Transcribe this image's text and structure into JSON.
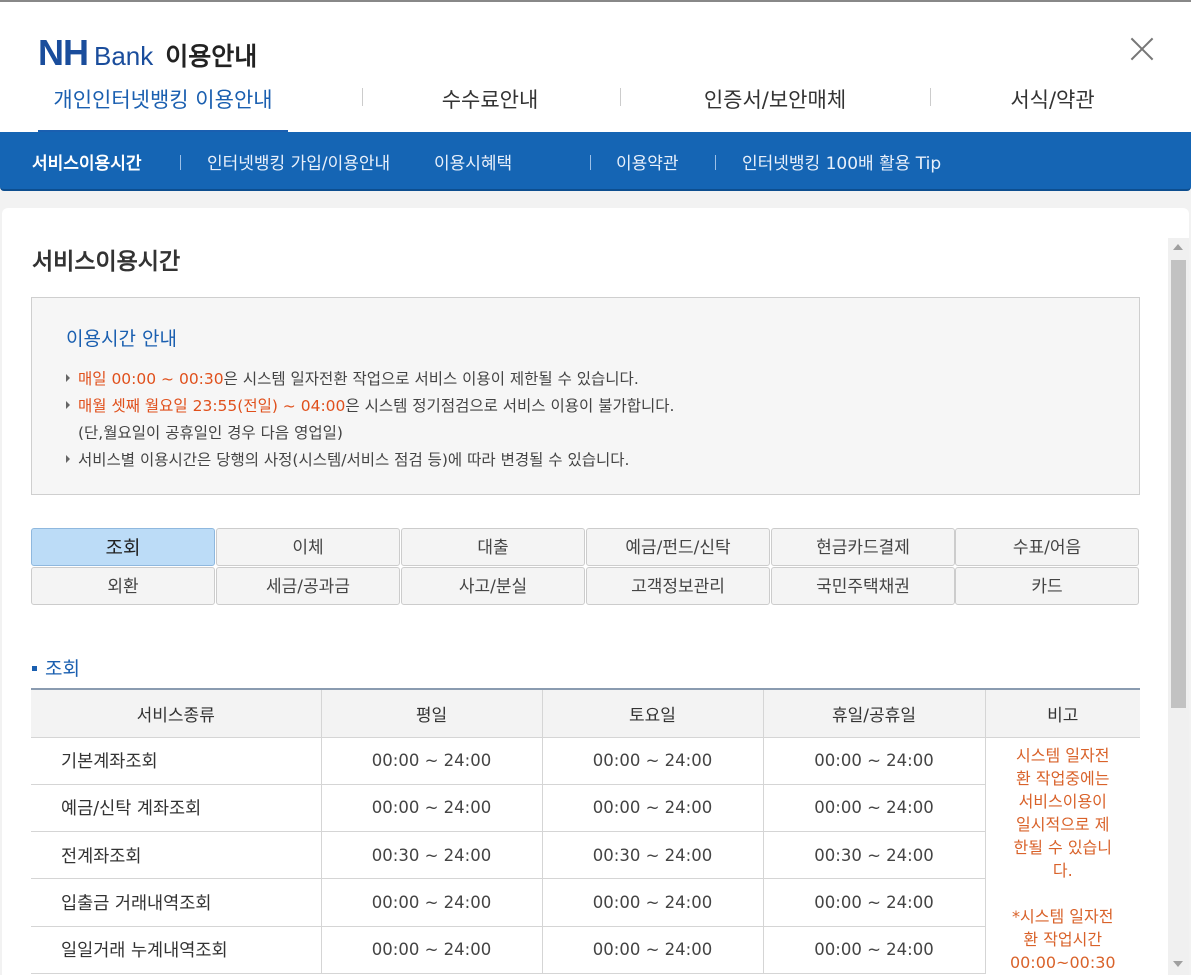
{
  "header": {
    "brand_nh": "NH",
    "brand_bank": "Bank",
    "title": "이용안내",
    "close_icon": "close-icon"
  },
  "main_tabs": [
    {
      "label": "개인인터넷뱅킹 이용안내",
      "active": true
    },
    {
      "label": "수수료안내",
      "active": false
    },
    {
      "label": "인증서/보안매체",
      "active": false
    },
    {
      "label": "서식/약관",
      "active": false
    }
  ],
  "subnav": [
    {
      "label": "서비스이용시간",
      "active": true
    },
    {
      "label": "인터넷뱅킹 가입/이용안내",
      "active": false
    },
    {
      "label": "이용시혜택",
      "active": false
    },
    {
      "label": "이용약관",
      "active": false
    },
    {
      "label": "인터넷뱅킹 100배 활용 Tip",
      "active": false
    }
  ],
  "page_title": "서비스이용시간",
  "notice": {
    "title": "이용시간 안내",
    "line1_hl": "매일 00:00 ~ 00:30",
    "line1_rest": "은 시스템 일자전환 작업으로 서비스 이용이 제한될 수 있습니다.",
    "line2_hl": "매월 셋째 월요일 23:55(전일) ~ 04:00",
    "line2_rest": "은 시스템 정기점검으로 서비스 이용이 불가합니다.",
    "line2_note": "(단,월요일이 공휴일인 경우 다음 영업일)",
    "line3": "서비스별 이용시간은 당행의 사정(시스템/서비스 점검 등)에 따라 변경될 수 있습니다."
  },
  "categories": [
    {
      "label": "조회",
      "active": true
    },
    {
      "label": "이체",
      "active": false
    },
    {
      "label": "대출",
      "active": false
    },
    {
      "label": "예금/펀드/신탁",
      "active": false
    },
    {
      "label": "현금카드결제",
      "active": false
    },
    {
      "label": "수표/어음",
      "active": false
    },
    {
      "label": "외환",
      "active": false
    },
    {
      "label": "세금/공과금",
      "active": false
    },
    {
      "label": "사고/분실",
      "active": false
    },
    {
      "label": "고객정보관리",
      "active": false
    },
    {
      "label": "국민주택채권",
      "active": false
    },
    {
      "label": "카드",
      "active": false
    }
  ],
  "section_title": "조회",
  "table": {
    "headers": [
      "서비스종류",
      "평일",
      "토요일",
      "휴일/공휴일",
      "비고"
    ],
    "rows": [
      [
        "기본계좌조회",
        "00:00 ~ 24:00",
        "00:00 ~ 24:00",
        "00:00 ~ 24:00"
      ],
      [
        "예금/신탁 계좌조회",
        "00:00 ~ 24:00",
        "00:00 ~ 24:00",
        "00:00 ~ 24:00"
      ],
      [
        "전계좌조회",
        "00:30 ~ 24:00",
        "00:30 ~ 24:00",
        "00:30 ~ 24:00"
      ],
      [
        "입출금 거래내역조회",
        "00:00 ~ 24:00",
        "00:00 ~ 24:00",
        "00:00 ~ 24:00"
      ],
      [
        "일일거래 누계내역조회",
        "00:00 ~ 24:00",
        "00:00 ~ 24:00",
        "00:00 ~ 24:00"
      ]
    ],
    "remark_lines": [
      "시스템 일자전",
      "환 작업중에는",
      "서비스이용이",
      "일시적으로 제",
      "한될 수 있습니",
      "다.",
      "",
      "*시스템 일자전",
      "환 작업시간",
      "00:00~00:30"
    ]
  }
}
